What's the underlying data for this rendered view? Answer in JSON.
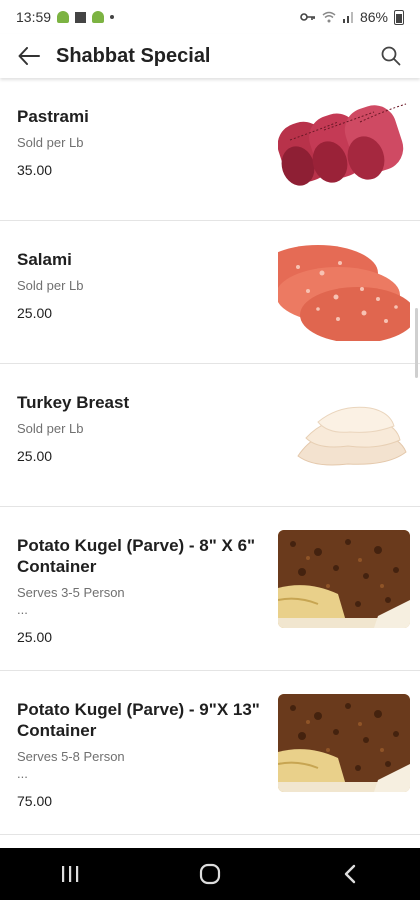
{
  "status_bar": {
    "time": "13:59",
    "battery": "86%"
  },
  "app_bar": {
    "title": "Shabbat  Special"
  },
  "items": [
    {
      "name": "Pastrami",
      "subtitle": "Sold per Lb",
      "extra": "",
      "price": "35.00",
      "image": "pastrami-rolls"
    },
    {
      "name": "Salami",
      "subtitle": "Sold per Lb",
      "extra": "",
      "price": "25.00",
      "image": "salami-slices"
    },
    {
      "name": "Turkey Breast",
      "subtitle": "Sold per Lb",
      "extra": "",
      "price": "25.00",
      "image": "turkey-slices"
    },
    {
      "name": "Potato Kugel (Parve) - 8\" X 6\" Container",
      "subtitle": "Serves 3-5 Person",
      "extra": "...",
      "price": "25.00",
      "image": "potato-kugel"
    },
    {
      "name": "Potato Kugel (Parve) - 9\"X 13\" Container",
      "subtitle": "Serves 5-8 Person",
      "extra": "...",
      "price": "75.00",
      "image": "potato-kugel"
    }
  ],
  "colors": {
    "nav_bar": "#000000",
    "divider": "#e4e4e4",
    "secondary_text": "#707070"
  },
  "icons": {
    "back": "arrow-left-icon",
    "search": "search-icon",
    "nav_recents": "recents-icon",
    "nav_home": "home-icon",
    "nav_back": "nav-back-icon"
  }
}
